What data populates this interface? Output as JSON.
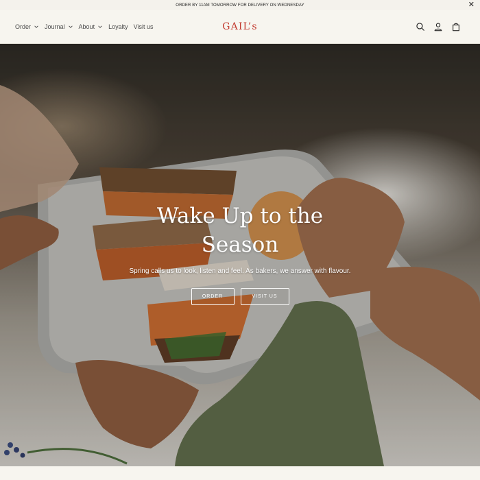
{
  "announcement": {
    "text": "ORDER BY 11AM TOMORROW FOR DELIVERY ON WEDNESDAY",
    "close_icon": "close-icon"
  },
  "nav": {
    "items": [
      {
        "label": "Order",
        "has_dropdown": true
      },
      {
        "label": "Journal",
        "has_dropdown": true
      },
      {
        "label": "About",
        "has_dropdown": true
      },
      {
        "label": "Loyalty",
        "has_dropdown": false
      },
      {
        "label": "Visit us",
        "has_dropdown": false
      }
    ]
  },
  "brand": {
    "logo_text": "GAIL’s",
    "color": "#c23a2f"
  },
  "header_icons": [
    "search-icon",
    "account-icon",
    "bag-icon"
  ],
  "hero": {
    "title": "Wake Up to the Season",
    "subtitle": "Spring calls us to look, listen and feel. As bakers, we answer with flavour.",
    "buttons": [
      {
        "label": "ORDER"
      },
      {
        "label": "VISIT US"
      }
    ]
  }
}
